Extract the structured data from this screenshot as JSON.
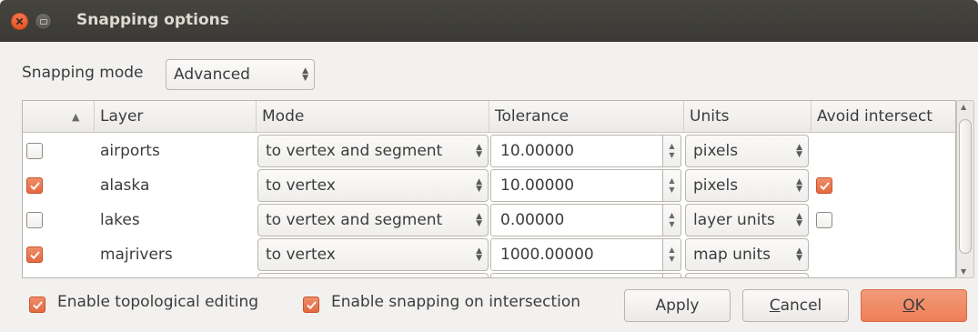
{
  "window": {
    "title": "Snapping options"
  },
  "snapping_mode": {
    "label": "Snapping mode",
    "value": "Advanced"
  },
  "table": {
    "headers": [
      "Layer",
      "Mode",
      "Tolerance",
      "Units",
      "Avoid intersect"
    ],
    "rows": [
      {
        "enabled": false,
        "layer": "airports",
        "mode": "to vertex and segment",
        "tolerance": "10.00000",
        "units": "pixels",
        "avoid_intersect": null
      },
      {
        "enabled": true,
        "layer": "alaska",
        "mode": "to vertex",
        "tolerance": "10.00000",
        "units": "pixels",
        "avoid_intersect": true
      },
      {
        "enabled": false,
        "layer": "lakes",
        "mode": "to vertex and segment",
        "tolerance": "0.00000",
        "units": "layer units",
        "avoid_intersect": false
      },
      {
        "enabled": true,
        "layer": "majrivers",
        "mode": "to vertex",
        "tolerance": "1000.00000",
        "units": "map units",
        "avoid_intersect": null
      }
    ]
  },
  "options": {
    "topological_editing": {
      "label": "Enable topological editing",
      "checked": true
    },
    "snap_on_intersection": {
      "label": "Enable snapping on intersection",
      "checked": true
    }
  },
  "buttons": {
    "apply": "Apply",
    "cancel_accel": "C",
    "cancel_rest": "ancel",
    "ok_accel": "O",
    "ok_rest": "K"
  },
  "colors": {
    "accent": "#e4693f",
    "titlebar": "#3c3b37"
  }
}
